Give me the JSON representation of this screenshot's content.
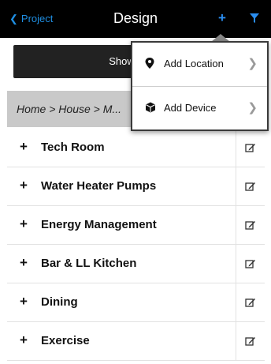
{
  "nav": {
    "back_label": "Project",
    "title": "Design",
    "add_icon": "plus-icon",
    "filter_icon": "filter-icon",
    "accent_color": "#1f8fe3"
  },
  "show_button": {
    "label": "Show"
  },
  "breadcrumb": {
    "text": "Home > House > M..."
  },
  "popover": {
    "items": [
      {
        "label": "Add Location",
        "icon": "map-pin-icon"
      },
      {
        "label": "Add Device",
        "icon": "cube-icon"
      }
    ]
  },
  "list": {
    "items": [
      {
        "label": "Tech Room"
      },
      {
        "label": "Water Heater Pumps"
      },
      {
        "label": "Energy Management"
      },
      {
        "label": "Bar & LL Kitchen"
      },
      {
        "label": "Dining"
      },
      {
        "label": "Exercise"
      }
    ]
  }
}
